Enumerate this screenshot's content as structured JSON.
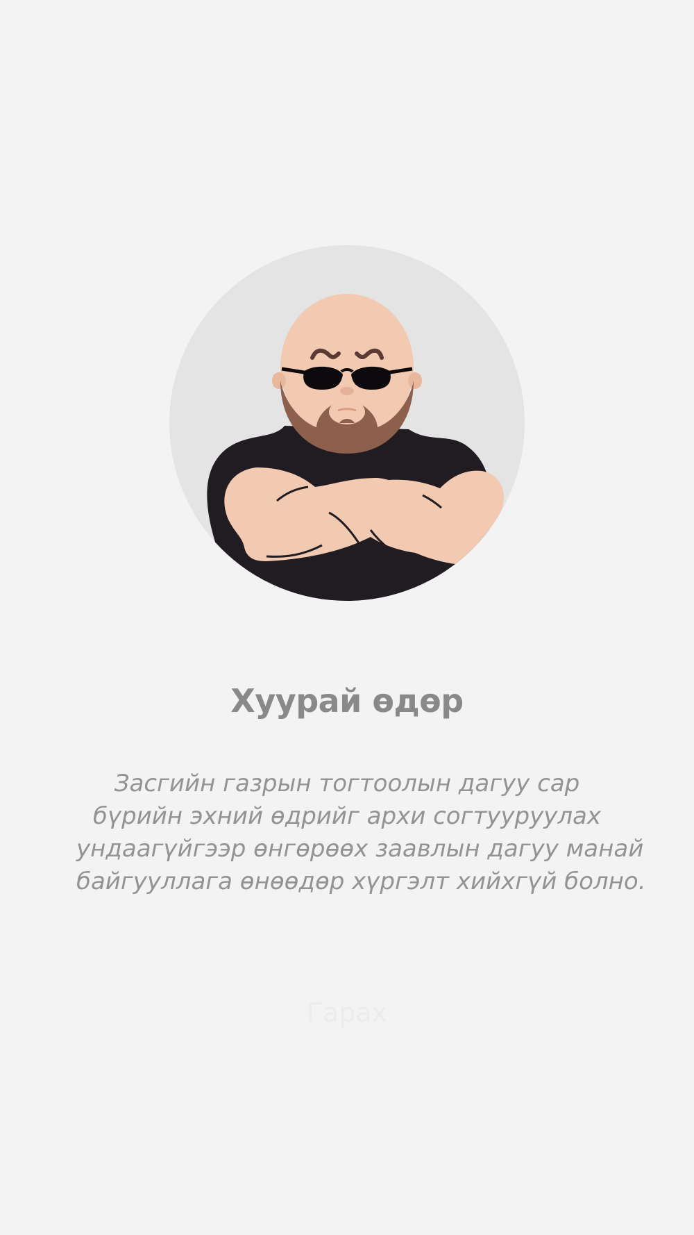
{
  "dialog": {
    "title": "Хуурай өдөр",
    "message_lines": [
      "Засгийн газрын тогтоолын дагуу сар",
      "бүрийн эхний өдрийг архи согтууруулах",
      "ундаагүйгээр өнгөрөөх заавлын дагуу манай",
      "байгууллага өнөөдөр хүргэлт хийхгүй болно."
    ],
    "exit_label": "Гарах"
  },
  "illustration": {
    "icon": "bouncer-icon",
    "colors": {
      "background_circle": "#e4e4e4",
      "skin": "#f2c9b1",
      "beard": "#8c604d",
      "shirt": "#211c21",
      "glasses": "#0c0a0c",
      "brows": "#5a3a32"
    }
  },
  "colors": {
    "page_background": "#f3f3f3",
    "title": "#8a898a",
    "message": "#949394",
    "exit_button": "#ececec"
  }
}
